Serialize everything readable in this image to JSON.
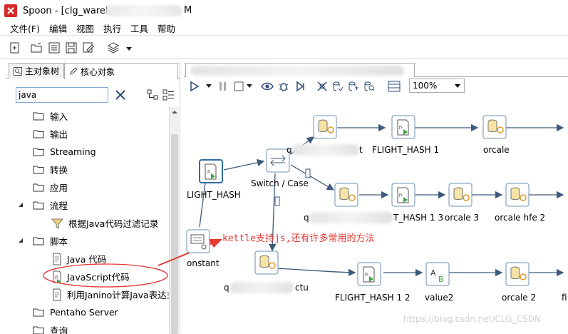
{
  "window": {
    "title_prefix": "Spoon - [clg_wareho",
    "title_suffix": "M"
  },
  "menu": [
    "文件(F)",
    "编辑",
    "视图",
    "执行",
    "工具",
    "帮助"
  ],
  "tabs": {
    "main_tree": "主对象树",
    "core_objects": "核心对象"
  },
  "search": {
    "value": "java"
  },
  "tree": {
    "items": [
      {
        "label": "输入",
        "type": "folder"
      },
      {
        "label": "输出",
        "type": "folder"
      },
      {
        "label": "Streaming",
        "type": "folder"
      },
      {
        "label": "转换",
        "type": "folder"
      },
      {
        "label": "应用",
        "type": "folder"
      },
      {
        "label": "流程",
        "type": "folder-open"
      },
      {
        "label": "根据Java代码过滤记录",
        "type": "step"
      },
      {
        "label": "脚本",
        "type": "folder-open"
      },
      {
        "label": "Java 代码",
        "type": "step"
      },
      {
        "label": "JavaScript代码",
        "type": "step"
      },
      {
        "label": "利用Janino计算Java表达式",
        "type": "step"
      },
      {
        "label": "Pentaho Server",
        "type": "folder"
      },
      {
        "label": "查询",
        "type": "folder"
      }
    ]
  },
  "canvas": {
    "zoom": "100%",
    "steps": {
      "flight_hash_left": "LIGHT_HASH",
      "switch_case": "Switch / Case",
      "q_top": "q",
      "q_top_suffix": "t",
      "flight_hash_1": "FLIGHT_HASH 1",
      "orcale": "orcale",
      "q_mid": "q",
      "flight_hash_13": "T_HASH 1 3",
      "orcale_3": "orcale 3",
      "orcale_hfe_2": "orcale hfe 2",
      "constant": "onstant",
      "q_bot": "q",
      "q_bot_suffix": "ctu",
      "flight_hash_12": "FLIGHT_HASH 1 2",
      "value2": "value2",
      "orcale_2": "orcale 2",
      "fi": "fi"
    }
  },
  "annotation": "kettle支持js,还有许多常用的方法",
  "watermark": "https://blog.csdn.net/CLG_CSDN",
  "colors": {
    "annotation_red": "#e53935",
    "ellipse_red": "#e53935",
    "hop_blue": "#3d5a7a",
    "step_border": "#6e8fb3",
    "selected_border": "#2e6da4"
  }
}
